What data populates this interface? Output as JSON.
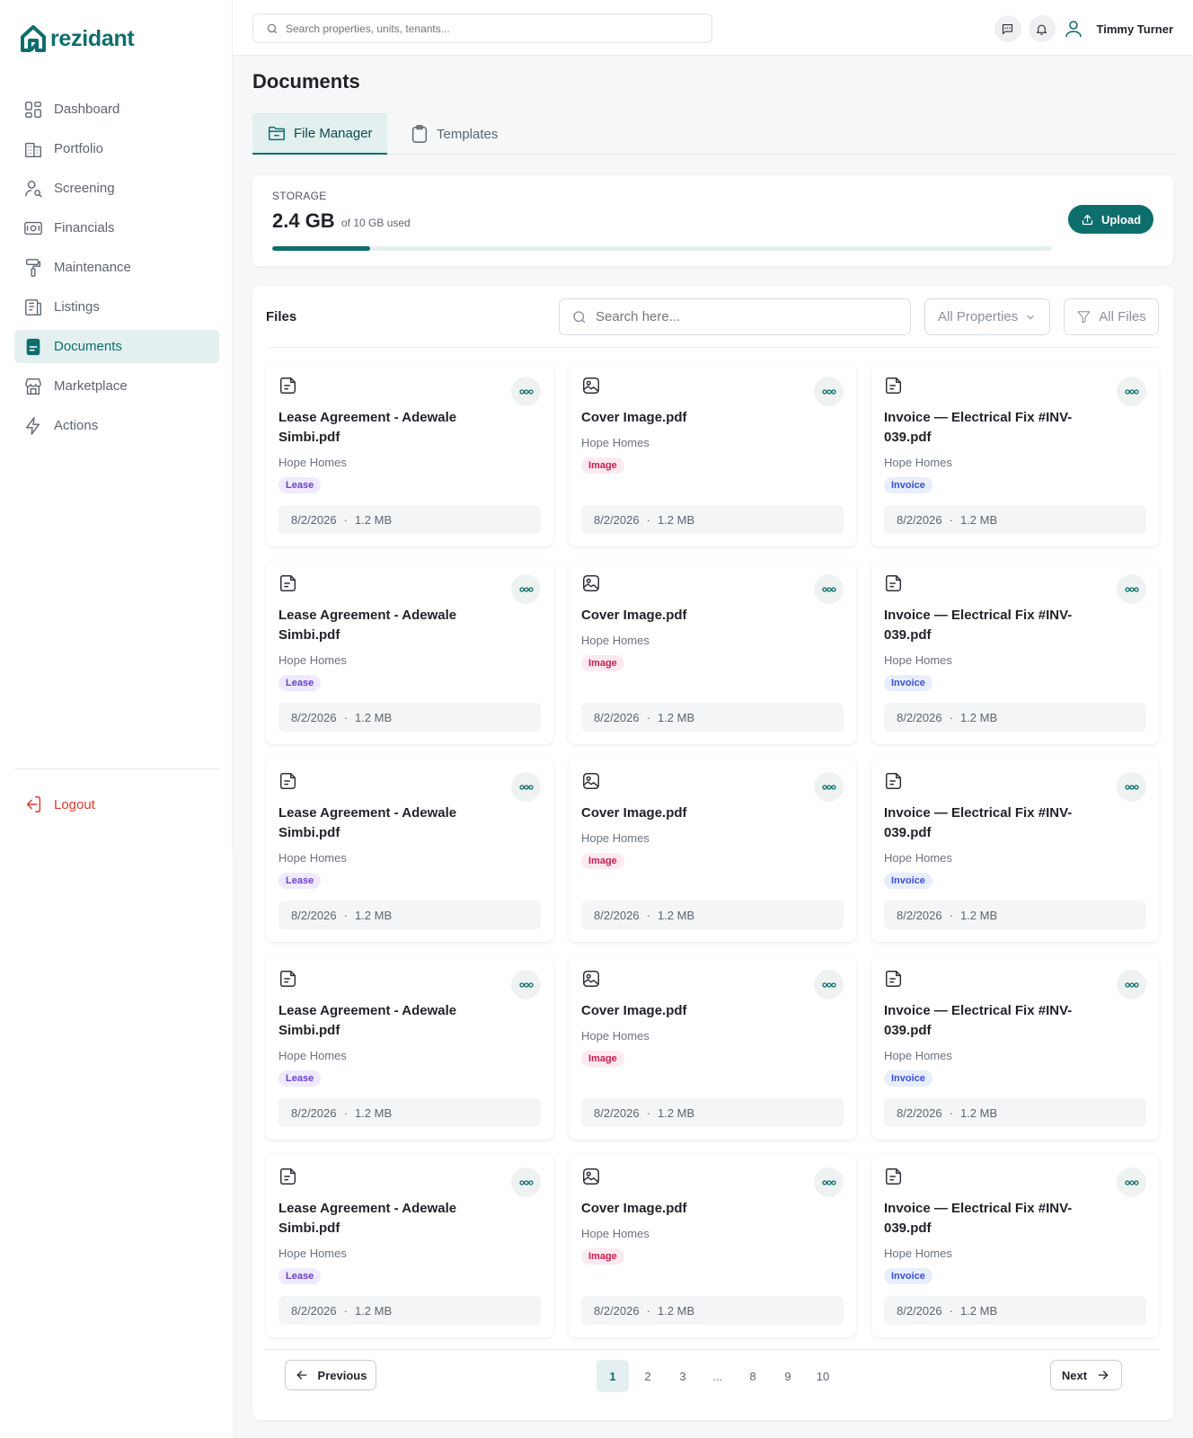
{
  "brand": {
    "name": "rezidant",
    "color": "#0e6e6c"
  },
  "sidebar": {
    "items": [
      {
        "label": "Dashboard",
        "icon": "dashboard-icon"
      },
      {
        "label": "Portfolio",
        "icon": "buildings-icon"
      },
      {
        "label": "Screening",
        "icon": "user-search-icon"
      },
      {
        "label": "Financials",
        "icon": "money-icon"
      },
      {
        "label": "Maintenance",
        "icon": "paint-roller-icon"
      },
      {
        "label": "Listings",
        "icon": "listing-icon"
      },
      {
        "label": "Documents",
        "icon": "document-icon",
        "active": true
      },
      {
        "label": "Marketplace",
        "icon": "store-icon"
      },
      {
        "label": "Actions",
        "icon": "lightning-icon"
      }
    ],
    "logout": "Logout"
  },
  "topbar": {
    "search_placeholder": "Search properties, units, tenants...",
    "user_name": "Timmy Turner"
  },
  "page": {
    "title": "Documents",
    "tabs": [
      {
        "label": "File Manager",
        "active": true
      },
      {
        "label": "Templates",
        "active": false
      }
    ]
  },
  "storage": {
    "label": "STORAGE",
    "used": "2.4 GB",
    "total_text": "of 10 GB used",
    "used_fraction": 0.125,
    "upload_label": "Upload"
  },
  "files": {
    "title": "Files",
    "search_placeholder": "Search here...",
    "property_filter": "All Properties",
    "type_filter": "All Files",
    "cards": [
      {
        "name": "Lease Agreement - Adewale Simbi.pdf",
        "property": "Hope Homes",
        "tag": "Lease",
        "date": "8/2/2026",
        "size": "1.2 MB",
        "kind": "doc"
      },
      {
        "name": "Cover Image.pdf",
        "property": "Hope Homes",
        "tag": "Image",
        "date": "8/2/2026",
        "size": "1.2 MB",
        "kind": "image"
      },
      {
        "name": "Invoice — Electrical Fix #INV-039.pdf",
        "property": "Hope Homes",
        "tag": "Invoice",
        "date": "8/2/2026",
        "size": "1.2 MB",
        "kind": "doc"
      },
      {
        "name": "Lease Agreement - Adewale Simbi.pdf",
        "property": "Hope Homes",
        "tag": "Lease",
        "date": "8/2/2026",
        "size": "1.2 MB",
        "kind": "doc"
      },
      {
        "name": "Cover Image.pdf",
        "property": "Hope Homes",
        "tag": "Image",
        "date": "8/2/2026",
        "size": "1.2 MB",
        "kind": "image"
      },
      {
        "name": "Invoice — Electrical Fix #INV-039.pdf",
        "property": "Hope Homes",
        "tag": "Invoice",
        "date": "8/2/2026",
        "size": "1.2 MB",
        "kind": "doc"
      },
      {
        "name": "Lease Agreement - Adewale Simbi.pdf",
        "property": "Hope Homes",
        "tag": "Lease",
        "date": "8/2/2026",
        "size": "1.2 MB",
        "kind": "doc"
      },
      {
        "name": "Cover Image.pdf",
        "property": "Hope Homes",
        "tag": "Image",
        "date": "8/2/2026",
        "size": "1.2 MB",
        "kind": "image"
      },
      {
        "name": "Invoice — Electrical Fix #INV-039.pdf",
        "property": "Hope Homes",
        "tag": "Invoice",
        "date": "8/2/2026",
        "size": "1.2 MB",
        "kind": "doc"
      },
      {
        "name": "Lease Agreement - Adewale Simbi.pdf",
        "property": "Hope Homes",
        "tag": "Lease",
        "date": "8/2/2026",
        "size": "1.2 MB",
        "kind": "doc"
      },
      {
        "name": "Cover Image.pdf",
        "property": "Hope Homes",
        "tag": "Image",
        "date": "8/2/2026",
        "size": "1.2 MB",
        "kind": "image"
      },
      {
        "name": "Invoice — Electrical Fix #INV-039.pdf",
        "property": "Hope Homes",
        "tag": "Invoice",
        "date": "8/2/2026",
        "size": "1.2 MB",
        "kind": "doc"
      },
      {
        "name": "Lease Agreement - Adewale Simbi.pdf",
        "property": "Hope Homes",
        "tag": "Lease",
        "date": "8/2/2026",
        "size": "1.2 MB",
        "kind": "doc"
      },
      {
        "name": "Cover Image.pdf",
        "property": "Hope Homes",
        "tag": "Image",
        "date": "8/2/2026",
        "size": "1.2 MB",
        "kind": "image"
      },
      {
        "name": "Invoice — Electrical Fix #INV-039.pdf",
        "property": "Hope Homes",
        "tag": "Invoice",
        "date": "8/2/2026",
        "size": "1.2 MB",
        "kind": "doc"
      }
    ],
    "tag_colors": {
      "Lease": {
        "bg": "#efeaff",
        "fg": "#6d3fd1"
      },
      "Image": {
        "bg": "#fdeaf0",
        "fg": "#c81e4f"
      },
      "Invoice": {
        "bg": "#e8eefe",
        "fg": "#3a4fd8"
      }
    }
  },
  "pagination": {
    "previous": "Previous",
    "next": "Next",
    "pages": [
      "1",
      "2",
      "3",
      "...",
      "8",
      "9",
      "10"
    ],
    "current": "1"
  }
}
